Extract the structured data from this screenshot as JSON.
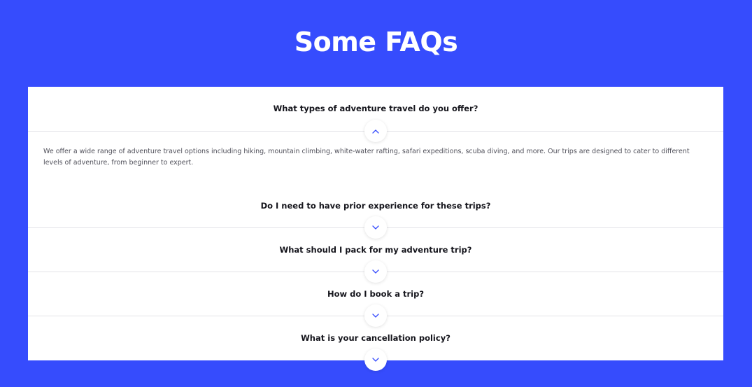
{
  "header": {
    "title": "Some FAQs"
  },
  "colors": {
    "background": "#364cfd",
    "panel": "#ffffff",
    "accent": "#364cfd"
  },
  "faq": {
    "items": [
      {
        "question": "What types of adventure travel do you offer?",
        "expanded": true,
        "toggle_icon": "chevron-up-icon",
        "answer": "We offer a wide range of adventure travel options including hiking, mountain climbing, white-water rafting, safari expeditions, scuba diving, and more. Our trips are designed to cater to different levels of adventure, from beginner to expert."
      },
      {
        "question": "Do I need to have prior experience for these trips?",
        "expanded": false,
        "toggle_icon": "chevron-down-icon"
      },
      {
        "question": "What should I pack for my adventure trip?",
        "expanded": false,
        "toggle_icon": "chevron-down-icon"
      },
      {
        "question": "How do I book a trip?",
        "expanded": false,
        "toggle_icon": "chevron-down-icon"
      },
      {
        "question": "What is your cancellation policy?",
        "expanded": false,
        "toggle_icon": "chevron-down-icon"
      }
    ]
  }
}
